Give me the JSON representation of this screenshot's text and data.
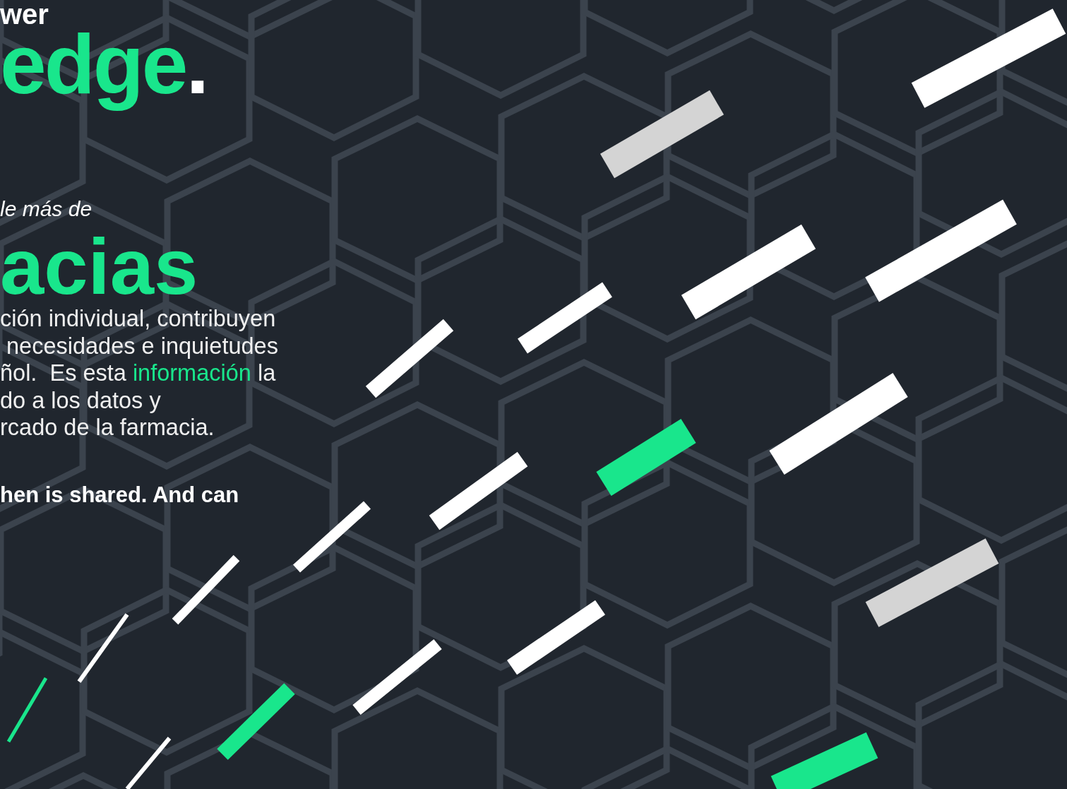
{
  "hero": {
    "headline_top": "wer",
    "headline_accent": "edge",
    "headline_dot": ".",
    "intro": "le más de",
    "big_word": "acias",
    "paragraph": [
      [
        {
          "kind": "plain",
          "text": "ción individual, contribuyen"
        }
      ],
      [
        {
          "kind": "plain",
          "text": " necesidades e inquietudes"
        }
      ],
      [
        {
          "kind": "plain",
          "text": "ñol.  Es esta "
        },
        {
          "kind": "link",
          "text": "información"
        },
        {
          "kind": "plain",
          "text": " la"
        }
      ],
      [
        {
          "kind": "plain",
          "text": "do a los datos y"
        }
      ],
      [
        {
          "kind": "plain",
          "text": "rcado de la farmacia."
        }
      ]
    ],
    "tagline": "hen is shared. And can"
  }
}
